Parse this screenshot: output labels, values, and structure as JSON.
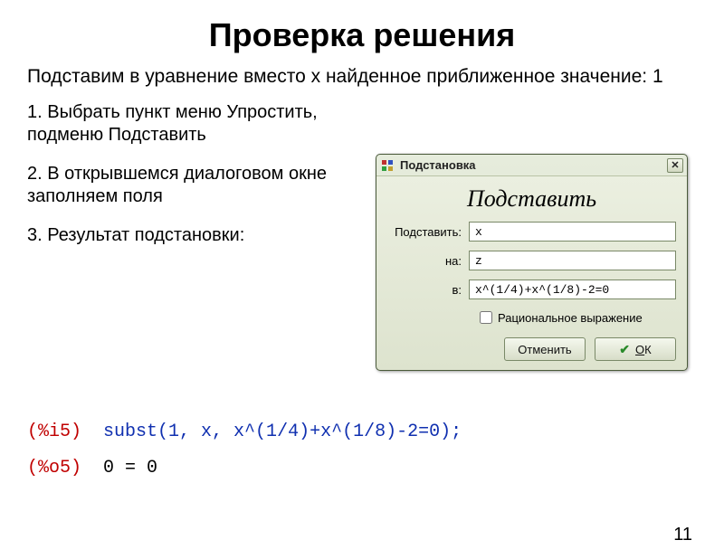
{
  "title": "Проверка решения",
  "intro": "Подставим в уравнение вместо x найденное приближенное значение: 1",
  "step1": "1. Выбрать пункт меню Упростить, подменю Подставить",
  "step2": "2. В открывшемся диалоговом окне заполняем поля",
  "step3": "3. Результат подстановки:",
  "dialog": {
    "window_title": "Подстановка",
    "header": "Подставить",
    "labels": {
      "what": "Подставить:",
      "with": "на:",
      "in": "в:"
    },
    "values": {
      "what": "x",
      "with": "z",
      "in": "x^(1/4)+x^(1/8)-2=0"
    },
    "rational": "Рациональное выражение",
    "cancel": "Отменить",
    "ok_prefix": "О",
    "ok_rest": "К"
  },
  "code": {
    "in_label": "(%i5)",
    "in_cmd": "subst(1, x, x^(1/4)+x^(1/8)-2=0);",
    "out_label": "(%o5)",
    "out_val": "0 = 0"
  },
  "page": "11"
}
